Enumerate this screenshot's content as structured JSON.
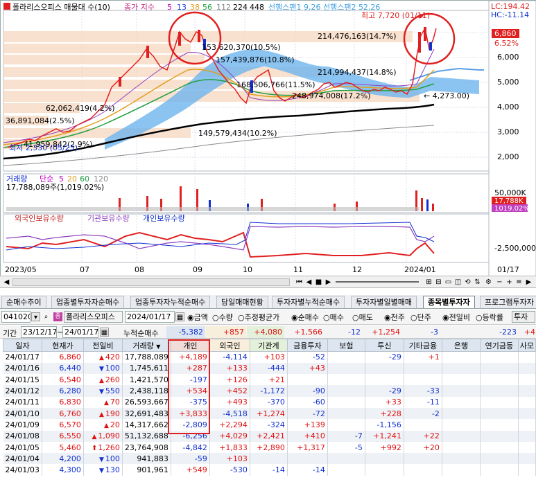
{
  "chart": {
    "header_title": "폴라리스오피스 매물대 수(10)",
    "ma_label": "종가 지수",
    "ma_periods": [
      "5",
      "13",
      "38",
      "56",
      "112",
      "224",
      "448"
    ],
    "span_label": "선행스팬1 9,26  선행스팬2 52,26",
    "high_label": "최고 7,720 (01/11)",
    "low_label": "최저 2,330 (05/25)",
    "lc_label": "LC:194.42",
    "hc_label": "HC:-11.14",
    "price_tag": "6,860",
    "pct_tag": "6.52%",
    "y_ticks": [
      "7,000",
      "6,000",
      "5,000",
      "4,000",
      "3,000",
      "2,000"
    ],
    "volume_bands": [
      "214,476,163(14.7%)",
      "153,620,370(10.5%)",
      "157,439,876(10.8%)",
      "214,994,437(14.8%)",
      "168,506,766(11.5%)",
      "248,974,008(17.2%)",
      "62,062,419(4.2%)",
      "36,891,084(2.5%)",
      "149,579,434(10.2%)",
      "41,959,842(2.9%)"
    ],
    "avg_label": "← 4,273.00)",
    "vol_panel_title": "거래량",
    "vol_ma_label": "단순",
    "vol_ma_periods": [
      "5",
      "20",
      "60",
      "120"
    ],
    "vol_value": "17,788,089주(1,019.02%)",
    "vol_tick": "50,000K",
    "vol_tag": "17,788K",
    "vol_pct_tag": "1019.02%",
    "flow_panel_title": "외국인보유수량",
    "flow_panel_title2": "기관보유수량",
    "flow_panel_title3": "개인보유수량",
    "flow_tick": "-2,500,000",
    "x_ticks": [
      "2023/05",
      "07",
      "08",
      "09",
      "10",
      "11",
      "12",
      "2024/01"
    ],
    "date_tag": "01/17"
  },
  "tabs": [
    "순매수추이",
    "업종별투자자순매수",
    "업종투자자누적순매수",
    "당일매매현황",
    "투자자별누적순매수",
    "투자자별일별매매",
    "종목별투자자",
    "프로그램투자자"
  ],
  "active_tab": "종목별투자자",
  "controls": {
    "code": "041020",
    "name": "폴라리스오피스",
    "date": "2024/01/17",
    "radio_group1": [
      "금액",
      "수량",
      "추정평균가"
    ],
    "radio_group2": [
      "순매수",
      "매수",
      "매도"
    ],
    "radio_group3": [
      "천주",
      "단주"
    ],
    "radio_group4": [
      "전일비",
      "등락률"
    ],
    "right_label": "투자"
  },
  "filter": {
    "period_label": "기간",
    "from": "23/12/17",
    "to": "24/01/17",
    "sum_label": "누적순매수",
    "sums": [
      "-5,382",
      "+857",
      "+4,080",
      "+1,566",
      "-12",
      "+1,254",
      "-3",
      "",
      "-223",
      "+4"
    ]
  },
  "table": {
    "headers": [
      "일자",
      "현재가",
      "전일비",
      "거래량",
      "개인",
      "외국인",
      "기관계",
      "금융투자",
      "보험",
      "투신",
      "기타금융",
      "은행",
      "연기금등",
      "사모"
    ],
    "rows": [
      {
        "date": "24/01/17",
        "price": "6,860",
        "dir": "up",
        "chg": "420",
        "vol": "17,788,089",
        "ind": "+4,189",
        "frg": "-4,114",
        "inst": "+103",
        "fin": "-52",
        "ins": "",
        "trust": "-29",
        "etc": "+1",
        "bank": "",
        "pen": "",
        "pe": ""
      },
      {
        "date": "24/01/16",
        "price": "6,440",
        "dir": "dn",
        "chg": "100",
        "vol": "1,745,611",
        "ind": "+287",
        "frg": "+133",
        "inst": "-444",
        "fin": "+43",
        "ins": "",
        "trust": "",
        "etc": "",
        "bank": "",
        "pen": "",
        "pe": ""
      },
      {
        "date": "24/01/15",
        "price": "6,540",
        "dir": "up",
        "chg": "260",
        "vol": "1,421,570",
        "ind": "-197",
        "frg": "+126",
        "inst": "+21",
        "fin": "",
        "ins": "",
        "trust": "",
        "etc": "",
        "bank": "",
        "pen": "",
        "pe": ""
      },
      {
        "date": "24/01/12",
        "price": "6,280",
        "dir": "dn",
        "chg": "550",
        "vol": "2,438,118",
        "ind": "+534",
        "frg": "+452",
        "inst": "-1,172",
        "fin": "-90",
        "ins": "",
        "trust": "-29",
        "etc": "-33",
        "bank": "",
        "pen": "",
        "pe": ""
      },
      {
        "date": "24/01/11",
        "price": "6,830",
        "dir": "up",
        "chg": "70",
        "vol": "26,593,667",
        "ind": "-375",
        "frg": "+493",
        "inst": "-370",
        "fin": "-60",
        "ins": "",
        "trust": "+33",
        "etc": "-11",
        "bank": "",
        "pen": "",
        "pe": ""
      },
      {
        "date": "24/01/10",
        "price": "6,760",
        "dir": "up",
        "chg": "190",
        "vol": "32,691,483",
        "ind": "+3,833",
        "frg": "-4,518",
        "inst": "+1,274",
        "fin": "-72",
        "ins": "",
        "trust": "+228",
        "etc": "-2",
        "bank": "",
        "pen": "",
        "pe": ""
      },
      {
        "date": "24/01/09",
        "price": "6,570",
        "dir": "up",
        "chg": "20",
        "vol": "14,317,662",
        "ind": "-2,809",
        "frg": "+2,294",
        "inst": "-324",
        "fin": "+139",
        "ins": "",
        "trust": "-1,156",
        "etc": "",
        "bank": "",
        "pen": "",
        "pe": ""
      },
      {
        "date": "24/01/08",
        "price": "6,550",
        "dir": "up",
        "chg": "1,090",
        "vol": "51,132,688",
        "ind": "-6,256",
        "frg": "+4,029",
        "inst": "+2,421",
        "fin": "+410",
        "ins": "-7",
        "trust": "+1,241",
        "etc": "+22",
        "bank": "",
        "pen": "",
        "pe": ""
      },
      {
        "date": "24/01/05",
        "price": "5,460",
        "dir": "limit",
        "chg": "1,260",
        "vol": "23,764,908",
        "ind": "-4,842",
        "frg": "+1,833",
        "inst": "+2,890",
        "fin": "+1,317",
        "ins": "-5",
        "trust": "+992",
        "etc": "+20",
        "bank": "",
        "pen": "",
        "pe": ""
      },
      {
        "date": "24/01/04",
        "price": "4,200",
        "dir": "dn",
        "chg": "100",
        "vol": "941,883",
        "ind": "-59",
        "frg": "+103",
        "inst": "",
        "fin": "",
        "ins": "",
        "trust": "",
        "etc": "",
        "bank": "",
        "pen": "",
        "pe": ""
      },
      {
        "date": "24/01/03",
        "price": "4,300",
        "dir": "dn",
        "chg": "130",
        "vol": "901,961",
        "ind": "+549",
        "frg": "-530",
        "inst": "-14",
        "fin": "-14",
        "ins": "",
        "trust": "",
        "etc": "",
        "bank": "",
        "pen": "",
        "pe": ""
      }
    ]
  }
}
